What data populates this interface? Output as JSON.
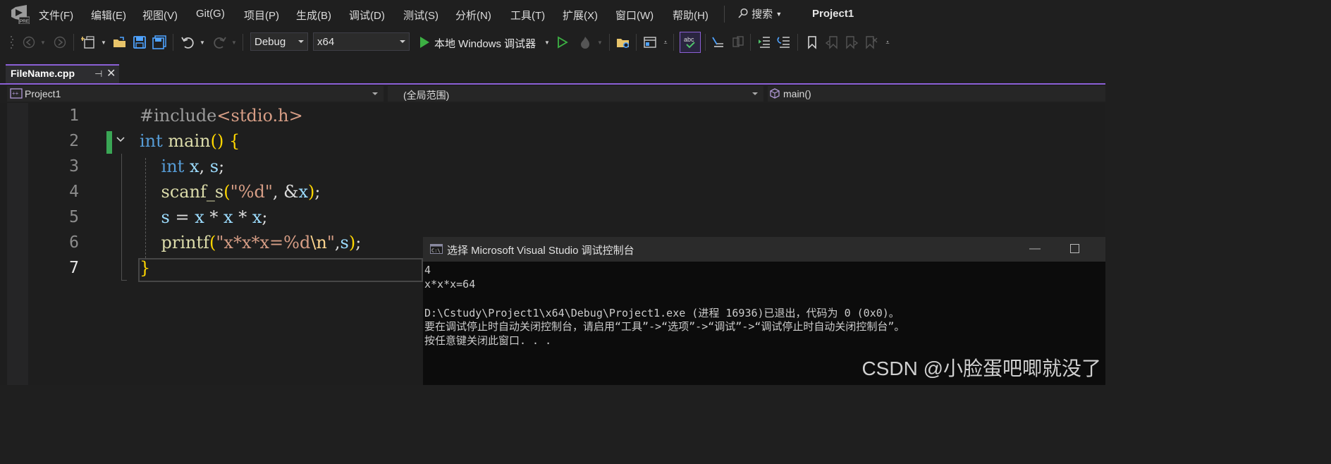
{
  "menubar": {
    "items": [
      "文件(F)",
      "编辑(E)",
      "视图(V)",
      "Git(G)",
      "项目(P)",
      "生成(B)",
      "调试(D)",
      "测试(S)",
      "分析(N)",
      "工具(T)",
      "扩展(X)",
      "窗口(W)",
      "帮助(H)"
    ],
    "search_label": "搜索",
    "project_title": "Project1",
    "logo_badge": "PRE"
  },
  "toolbar": {
    "config_value": "Debug",
    "platform_value": "x64",
    "debugger_label": "本地 Windows 调试器"
  },
  "tab": {
    "filename": "FileName.cpp",
    "pin_glyph": "⊣",
    "close_glyph": "✕"
  },
  "navbar": {
    "project": "Project1",
    "scope": "(全局范围)",
    "member": "main()"
  },
  "editor": {
    "line_numbers": [
      "1",
      "2",
      "3",
      "4",
      "5",
      "6",
      "7"
    ],
    "lines": [
      "#include<stdio.h>",
      "int main() {",
      "    int x, s;",
      "    scanf_s(\"%d\", &x);",
      "    s = x * x * x;",
      "    printf(\"x*x*x=%d\\n\",s);",
      "}"
    ]
  },
  "console": {
    "title": "选择 Microsoft Visual Studio 调试控制台",
    "icon_text": "C:\\",
    "lines": [
      "4",
      "x*x*x=64",
      "",
      "D:\\Cstudy\\Project1\\x64\\Debug\\Project1.exe (进程 16936)已退出，代码为 0 (0x0)。",
      "要在调试停止时自动关闭控制台，请启用“工具”->“选项”->“调试”->“调试停止时自动关闭控制台”。",
      "按任意键关闭此窗口. . ."
    ]
  },
  "watermark": "CSDN @小脸蛋吧唧就没了",
  "colors": {
    "accent": "#8b5fd6",
    "keyword": "#569cd6",
    "function": "#dcdcaa",
    "variable": "#9cdcfe",
    "string": "#d69d85",
    "change_bar": "#3aa655",
    "play": "#3cb043"
  }
}
